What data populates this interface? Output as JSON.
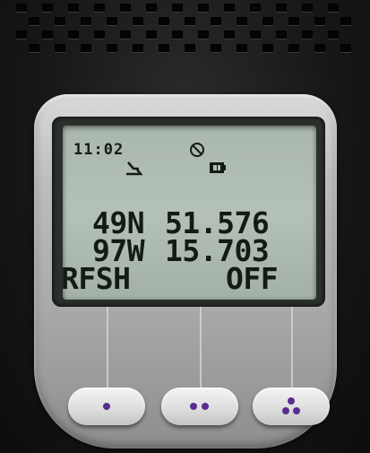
{
  "display": {
    "time": "11:02",
    "latitude": {
      "hemisphere": "49N",
      "minutes": "51.576"
    },
    "longitude": {
      "hemisphere": "97W",
      "minutes": "15.703"
    },
    "refresh": {
      "label": "RFSH",
      "value": "OFF"
    }
  },
  "status_icons": [
    "satellite-icon",
    "signal-icon",
    "battery-icon"
  ],
  "soft_keys": [
    {
      "name": "soft-key-1",
      "dots": 1
    },
    {
      "name": "soft-key-2",
      "dots": 2
    },
    {
      "name": "soft-key-3",
      "dots": 3
    }
  ],
  "colors": {
    "lcd_background": "#b0bdb2",
    "lcd_text": "#141a16",
    "bezel": "#bdbdbd",
    "key_dot": "#5a2d91"
  }
}
